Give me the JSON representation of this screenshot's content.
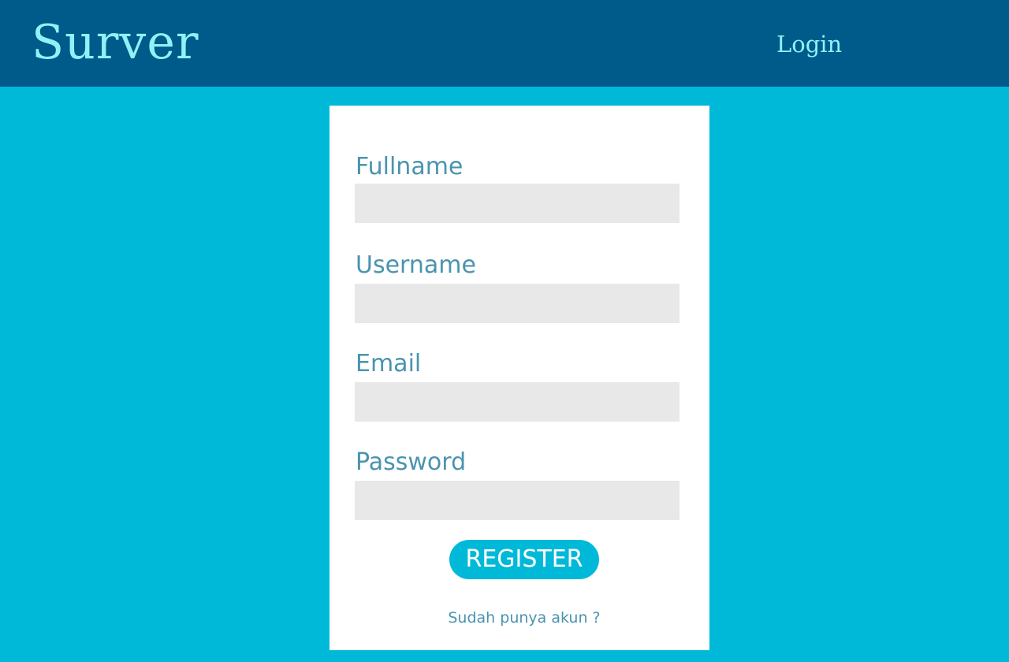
{
  "header": {
    "brand": "Surver",
    "nav_login": "Login"
  },
  "form": {
    "fields": [
      {
        "label": "Fullname",
        "value": "",
        "placeholder": ""
      },
      {
        "label": "Username",
        "value": "",
        "placeholder": ""
      },
      {
        "label": "Email",
        "value": "",
        "placeholder": ""
      },
      {
        "label": "Password",
        "value": "",
        "placeholder": ""
      }
    ],
    "submit_label": "REGISTER",
    "login_prompt": "Sudah punya akun ?"
  },
  "colors": {
    "header_bg": "#005a8a",
    "page_bg": "#00b9d9",
    "brand_text": "#8ff2f8",
    "label_text": "#4a94ae",
    "input_bg": "#e8e8e8",
    "button_bg": "#00b9d9"
  }
}
